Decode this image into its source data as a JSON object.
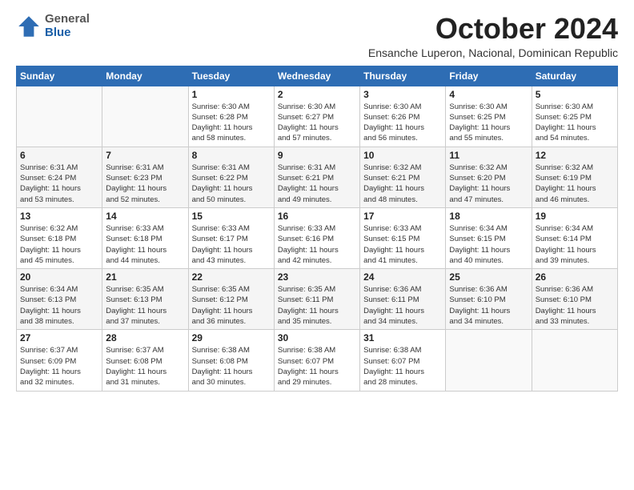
{
  "header": {
    "logo": {
      "general": "General",
      "blue": "Blue"
    },
    "month": "October 2024",
    "subtitle": "Ensanche Luperon, Nacional, Dominican Republic"
  },
  "weekdays": [
    "Sunday",
    "Monday",
    "Tuesday",
    "Wednesday",
    "Thursday",
    "Friday",
    "Saturday"
  ],
  "weeks": [
    [
      {
        "day": "",
        "info": ""
      },
      {
        "day": "",
        "info": ""
      },
      {
        "day": "1",
        "info": "Sunrise: 6:30 AM\nSunset: 6:28 PM\nDaylight: 11 hours\nand 58 minutes."
      },
      {
        "day": "2",
        "info": "Sunrise: 6:30 AM\nSunset: 6:27 PM\nDaylight: 11 hours\nand 57 minutes."
      },
      {
        "day": "3",
        "info": "Sunrise: 6:30 AM\nSunset: 6:26 PM\nDaylight: 11 hours\nand 56 minutes."
      },
      {
        "day": "4",
        "info": "Sunrise: 6:30 AM\nSunset: 6:25 PM\nDaylight: 11 hours\nand 55 minutes."
      },
      {
        "day": "5",
        "info": "Sunrise: 6:30 AM\nSunset: 6:25 PM\nDaylight: 11 hours\nand 54 minutes."
      }
    ],
    [
      {
        "day": "6",
        "info": "Sunrise: 6:31 AM\nSunset: 6:24 PM\nDaylight: 11 hours\nand 53 minutes."
      },
      {
        "day": "7",
        "info": "Sunrise: 6:31 AM\nSunset: 6:23 PM\nDaylight: 11 hours\nand 52 minutes."
      },
      {
        "day": "8",
        "info": "Sunrise: 6:31 AM\nSunset: 6:22 PM\nDaylight: 11 hours\nand 50 minutes."
      },
      {
        "day": "9",
        "info": "Sunrise: 6:31 AM\nSunset: 6:21 PM\nDaylight: 11 hours\nand 49 minutes."
      },
      {
        "day": "10",
        "info": "Sunrise: 6:32 AM\nSunset: 6:21 PM\nDaylight: 11 hours\nand 48 minutes."
      },
      {
        "day": "11",
        "info": "Sunrise: 6:32 AM\nSunset: 6:20 PM\nDaylight: 11 hours\nand 47 minutes."
      },
      {
        "day": "12",
        "info": "Sunrise: 6:32 AM\nSunset: 6:19 PM\nDaylight: 11 hours\nand 46 minutes."
      }
    ],
    [
      {
        "day": "13",
        "info": "Sunrise: 6:32 AM\nSunset: 6:18 PM\nDaylight: 11 hours\nand 45 minutes."
      },
      {
        "day": "14",
        "info": "Sunrise: 6:33 AM\nSunset: 6:18 PM\nDaylight: 11 hours\nand 44 minutes."
      },
      {
        "day": "15",
        "info": "Sunrise: 6:33 AM\nSunset: 6:17 PM\nDaylight: 11 hours\nand 43 minutes."
      },
      {
        "day": "16",
        "info": "Sunrise: 6:33 AM\nSunset: 6:16 PM\nDaylight: 11 hours\nand 42 minutes."
      },
      {
        "day": "17",
        "info": "Sunrise: 6:33 AM\nSunset: 6:15 PM\nDaylight: 11 hours\nand 41 minutes."
      },
      {
        "day": "18",
        "info": "Sunrise: 6:34 AM\nSunset: 6:15 PM\nDaylight: 11 hours\nand 40 minutes."
      },
      {
        "day": "19",
        "info": "Sunrise: 6:34 AM\nSunset: 6:14 PM\nDaylight: 11 hours\nand 39 minutes."
      }
    ],
    [
      {
        "day": "20",
        "info": "Sunrise: 6:34 AM\nSunset: 6:13 PM\nDaylight: 11 hours\nand 38 minutes."
      },
      {
        "day": "21",
        "info": "Sunrise: 6:35 AM\nSunset: 6:13 PM\nDaylight: 11 hours\nand 37 minutes."
      },
      {
        "day": "22",
        "info": "Sunrise: 6:35 AM\nSunset: 6:12 PM\nDaylight: 11 hours\nand 36 minutes."
      },
      {
        "day": "23",
        "info": "Sunrise: 6:35 AM\nSunset: 6:11 PM\nDaylight: 11 hours\nand 35 minutes."
      },
      {
        "day": "24",
        "info": "Sunrise: 6:36 AM\nSunset: 6:11 PM\nDaylight: 11 hours\nand 34 minutes."
      },
      {
        "day": "25",
        "info": "Sunrise: 6:36 AM\nSunset: 6:10 PM\nDaylight: 11 hours\nand 34 minutes."
      },
      {
        "day": "26",
        "info": "Sunrise: 6:36 AM\nSunset: 6:10 PM\nDaylight: 11 hours\nand 33 minutes."
      }
    ],
    [
      {
        "day": "27",
        "info": "Sunrise: 6:37 AM\nSunset: 6:09 PM\nDaylight: 11 hours\nand 32 minutes."
      },
      {
        "day": "28",
        "info": "Sunrise: 6:37 AM\nSunset: 6:08 PM\nDaylight: 11 hours\nand 31 minutes."
      },
      {
        "day": "29",
        "info": "Sunrise: 6:38 AM\nSunset: 6:08 PM\nDaylight: 11 hours\nand 30 minutes."
      },
      {
        "day": "30",
        "info": "Sunrise: 6:38 AM\nSunset: 6:07 PM\nDaylight: 11 hours\nand 29 minutes."
      },
      {
        "day": "31",
        "info": "Sunrise: 6:38 AM\nSunset: 6:07 PM\nDaylight: 11 hours\nand 28 minutes."
      },
      {
        "day": "",
        "info": ""
      },
      {
        "day": "",
        "info": ""
      }
    ]
  ]
}
